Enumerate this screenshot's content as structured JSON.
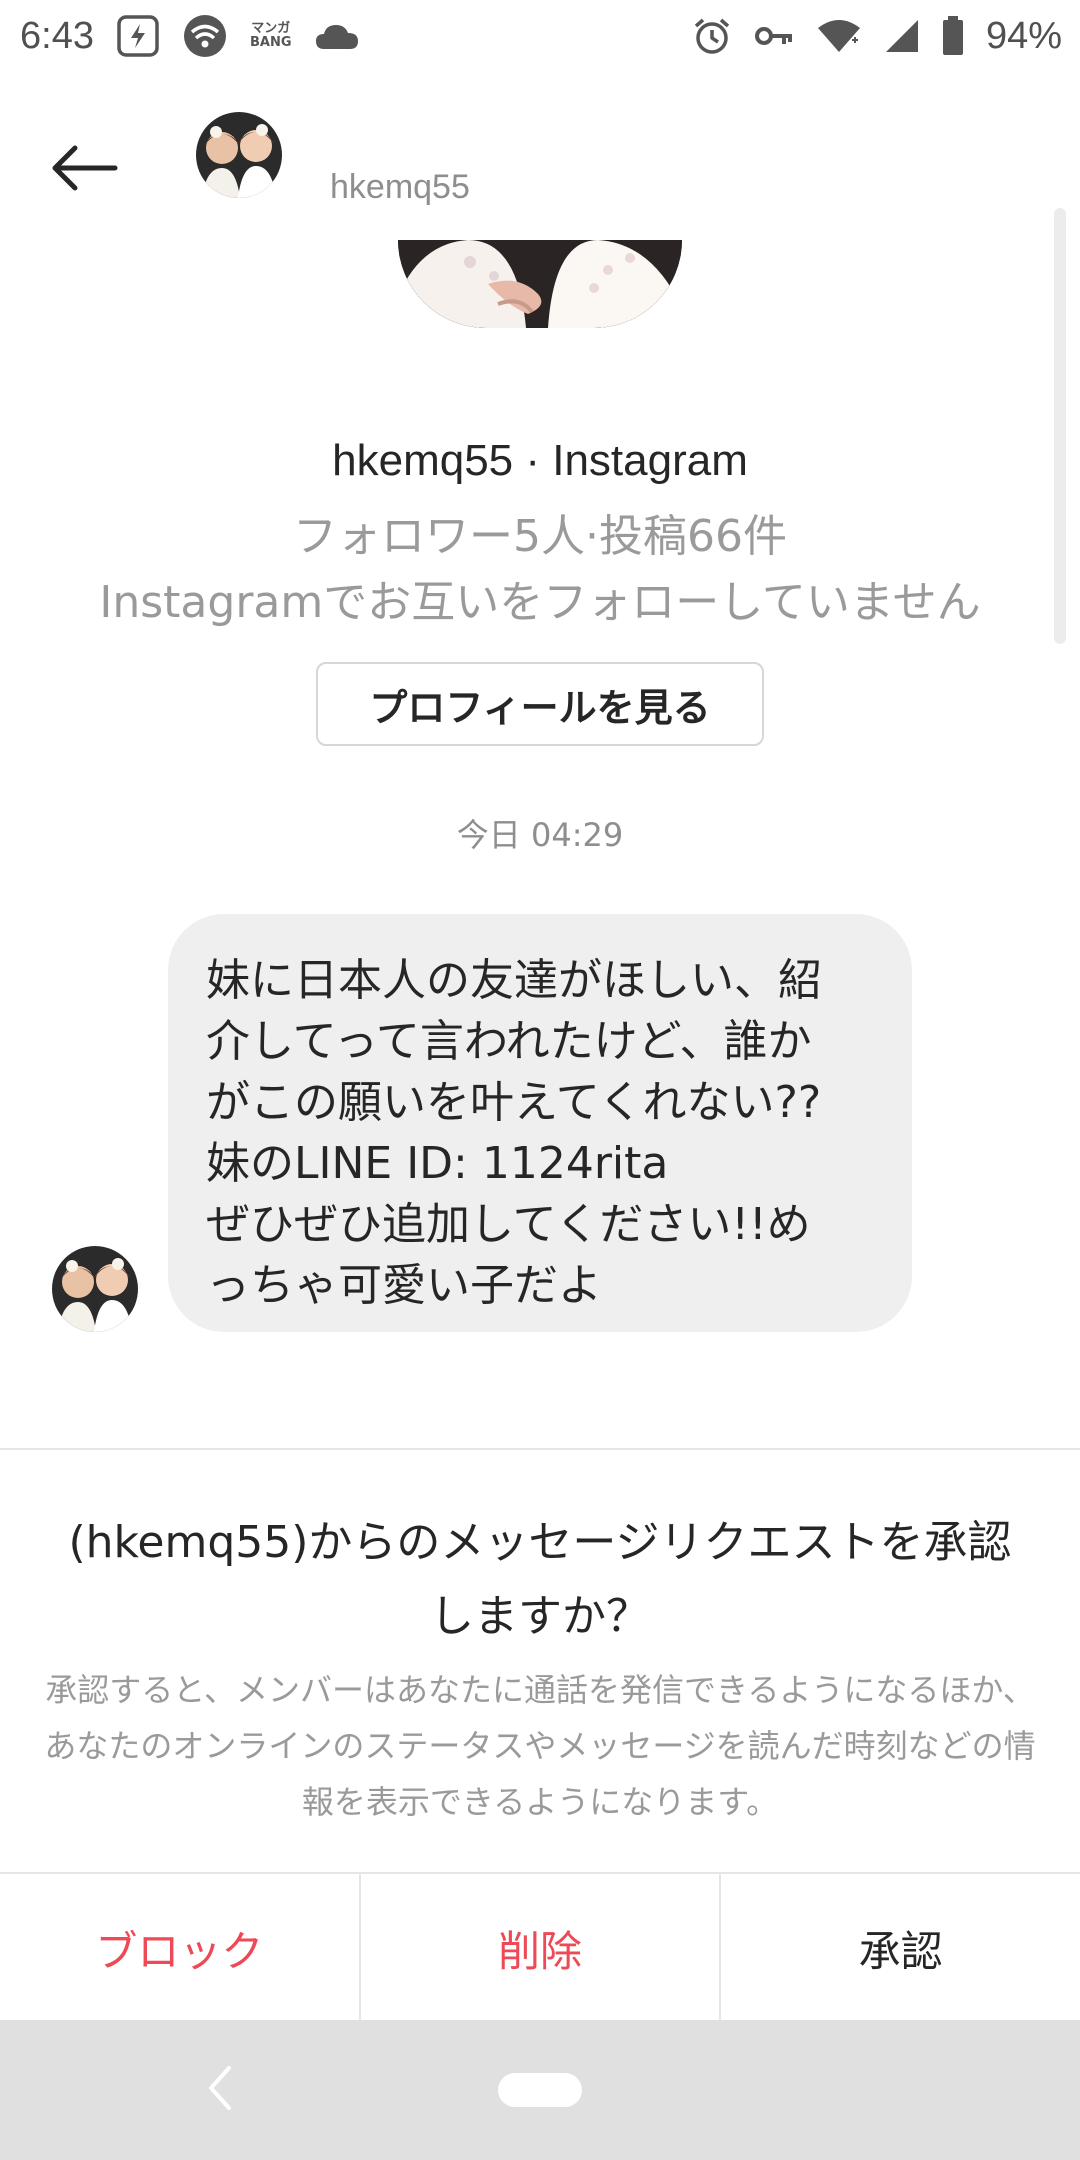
{
  "status_bar": {
    "time": "6:43",
    "manga_line1": "マンガ",
    "manga_line2": "BANG",
    "battery": "94%",
    "icons": [
      "app-badge-icon",
      "wifi-hotspot-icon",
      "cloud-icon",
      "alarm-icon",
      "vpn-key-icon",
      "wifi-icon",
      "cell-signal-icon",
      "battery-icon"
    ]
  },
  "header": {
    "username": "hkemq55",
    "back_icon": "arrow-left-icon"
  },
  "profile": {
    "title": "hkemq55 · Instagram",
    "stats": "フォロワー5人·投稿66件",
    "follow_status": "Instagramでお互いをフォローしていません",
    "view_profile_label": "プロフィールを見る"
  },
  "conversation": {
    "timestamp": "今日 04:29",
    "messages": [
      {
        "text": "妹に日本人の友達がほしい、紹\n介してって言われたけど、誰か\nがこの願いを叶えてくれない??\n妹のLINE ID: 1124rita\nぜひぜひ追加してください!!め\nっちゃ可愛い子だよ"
      }
    ]
  },
  "request": {
    "title": "(hkemq55)からのメッセージリクエストを承認しますか？",
    "description": "承認すると、メンバーはあなたに通話を発信できるようになるほか、あなたのオンラインのステータスやメッセージを読んだ時刻などの情報を表示できるようになります。",
    "block_label": "ブロック",
    "delete_label": "削除",
    "accept_label": "承認",
    "colors": {
      "destructive": "#ed4956",
      "neutral": "#262626"
    }
  },
  "nav_bar": {
    "icons": [
      "nav-back-icon",
      "nav-home-pill"
    ]
  }
}
